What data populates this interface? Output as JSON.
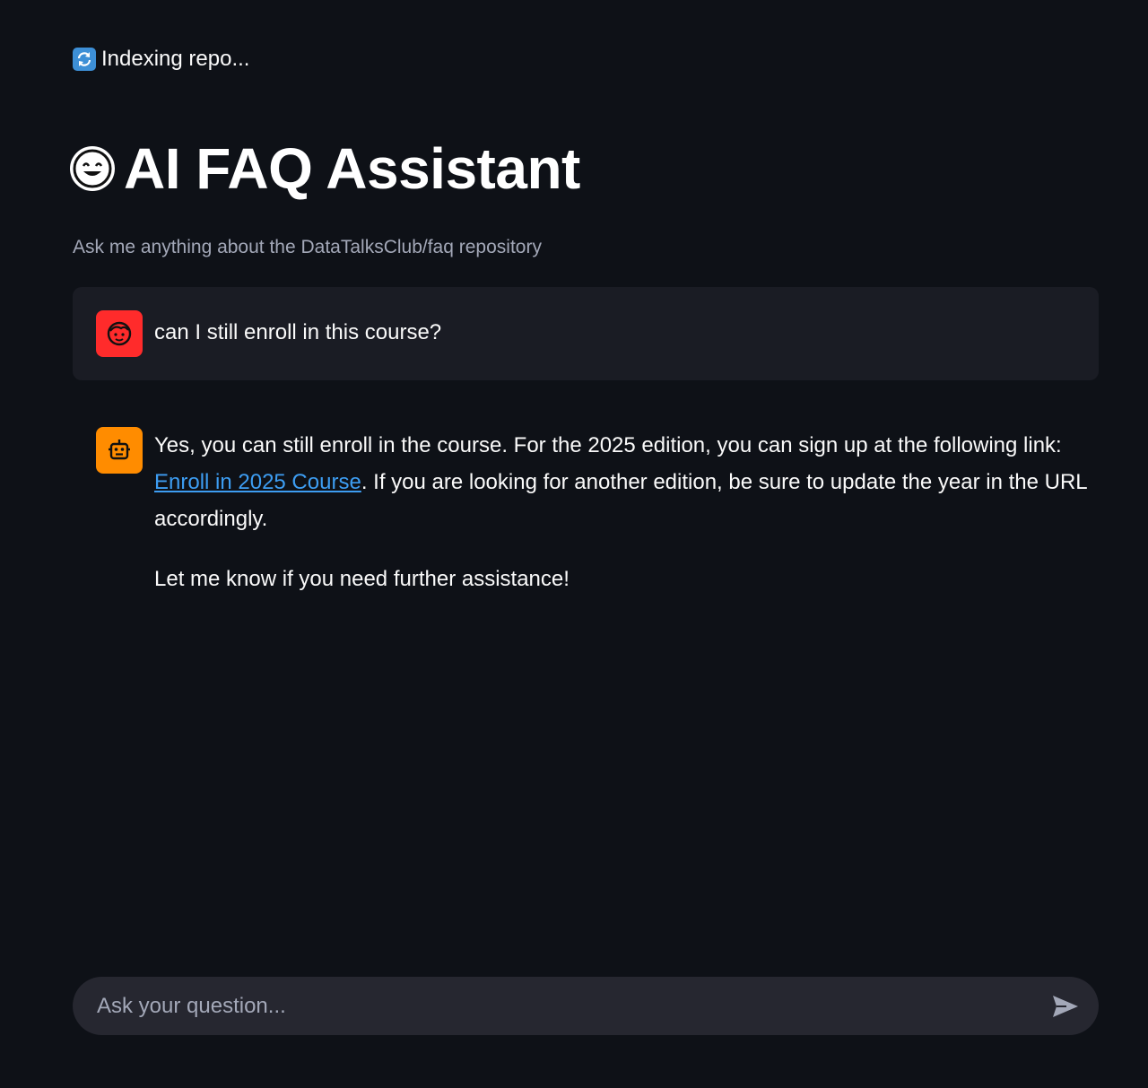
{
  "status": {
    "icon": "refresh-icon",
    "text": "Indexing repo..."
  },
  "header": {
    "icon": "grinning-face-icon",
    "title": "AI FAQ Assistant",
    "subtitle": "Ask me anything about the DataTalksClub/faq repository"
  },
  "messages": [
    {
      "role": "user",
      "avatar_icon": "user-face-icon",
      "avatar_color": "#ff2b2b",
      "text": "can I still enroll in this course?"
    },
    {
      "role": "assistant",
      "avatar_icon": "robot-icon",
      "avatar_color": "#ff8c00",
      "p1_before": "Yes, you can still enroll in the course. For the 2025 edition, you can sign up at the following link: ",
      "link_text": "Enroll in 2025 Course",
      "p1_after": ". If you are looking for another edition, be sure to update the year in the URL accordingly.",
      "p2": "Let me know if you need further assistance!"
    }
  ],
  "input": {
    "placeholder": "Ask your question...",
    "send_icon": "send-icon"
  },
  "colors": {
    "background": "#0e1117",
    "link": "#3d9df2",
    "input_bg": "#262730",
    "user_msg_bg": "#1a1c24"
  }
}
